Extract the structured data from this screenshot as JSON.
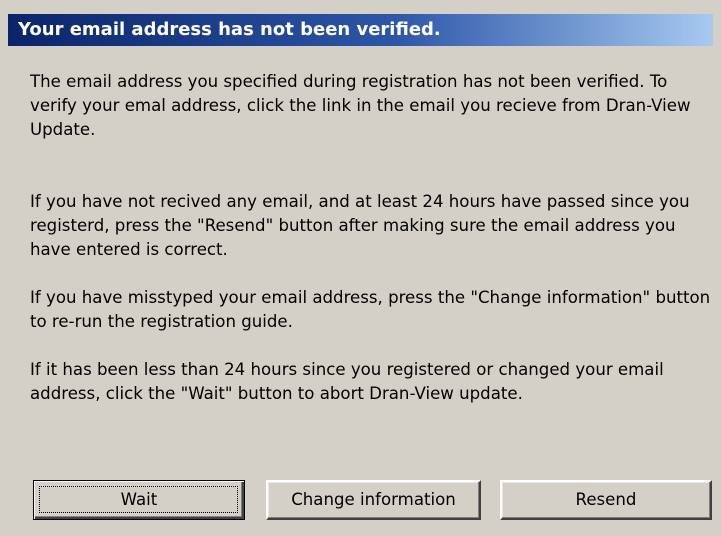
{
  "dialog": {
    "title": "Your email address has not been verified.",
    "paragraphs": [
      "The email address you specified during registration has not been verified. To verify your emal address, click the link in the email you recieve from Dran-View Update.",
      "If you have not recived any email, and at least 24 hours have passed since you registerd, press the \"Resend\" button after making sure the email address you have entered is correct.",
      "If you have misstyped your email address, press the \"Change information\" button to re-run the registration guide.",
      "If it has been less than 24 hours since you registered or changed your email address, click the \"Wait\" button to abort Dran-View update."
    ],
    "buttons": {
      "wait": "Wait",
      "change": "Change information",
      "resend": "Resend"
    },
    "colors": {
      "title_bar_start": "#0a246a",
      "title_bar_end": "#a6caf0",
      "background": "#d4d0c8"
    }
  }
}
